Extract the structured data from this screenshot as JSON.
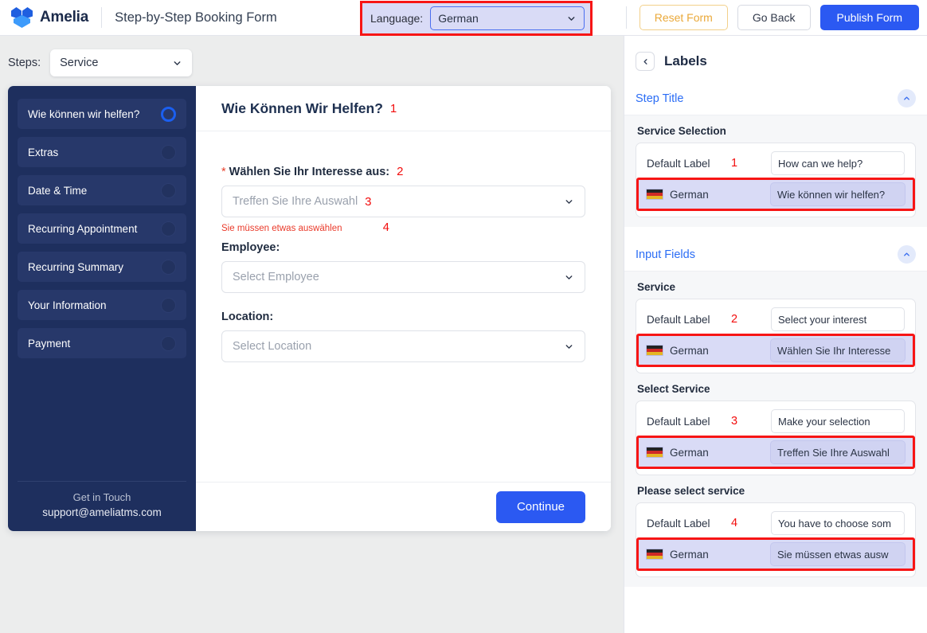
{
  "topbar": {
    "brand": "Amelia",
    "form_title": "Step-by-Step Booking Form",
    "language_label": "Language:",
    "language_value": "German",
    "reset_label": "Reset Form",
    "goback_label": "Go Back",
    "publish_label": "Publish Form",
    "accent_blue": "#2b59f2",
    "highlight_red": "#f71515",
    "lang_bg": "#d9dbf6"
  },
  "steps_bar": {
    "label": "Steps:",
    "value": "Service"
  },
  "booking": {
    "sidebar_steps": [
      {
        "label": "Wie können wir helfen?",
        "active": true
      },
      {
        "label": "Extras",
        "active": false
      },
      {
        "label": "Date & Time",
        "active": false
      },
      {
        "label": "Recurring Appointment",
        "active": false
      },
      {
        "label": "Recurring Summary",
        "active": false
      },
      {
        "label": "Your Information",
        "active": false
      },
      {
        "label": "Payment",
        "active": false
      }
    ],
    "get_in_touch": "Get in Touch",
    "support_email": "support@ameliatms.com",
    "step_title": "Wie Können Wir Helfen?",
    "step_title_marker": "1",
    "interest_label": "Wählen Sie Ihr Interesse aus:",
    "interest_required_mark": "*",
    "interest_marker": "2",
    "interest_placeholder": "Treffen Sie Ihre Auswahl",
    "interest_placeholder_marker": "3",
    "interest_error": "Sie müssen etwas auswählen",
    "interest_error_marker": "4",
    "employee_label": "Employee:",
    "employee_placeholder": "Select Employee",
    "location_label": "Location:",
    "location_placeholder": "Select Location",
    "continue_label": "Continue"
  },
  "right_panel": {
    "title": "Labels",
    "sections": [
      {
        "title": "Step Title",
        "collapsed": false
      },
      {
        "title": "Input Fields",
        "collapsed": false
      }
    ],
    "groups": [
      {
        "section": "Step Title",
        "group_title": "Service Selection",
        "default_row_label": "Default Label",
        "marker": "1",
        "default_value": "How can we help?",
        "lang_name": "German",
        "lang_value": "Wie können wir helfen?"
      },
      {
        "section": "Input Fields",
        "group_title": "Service",
        "default_row_label": "Default Label",
        "marker": "2",
        "default_value": "Select your interest",
        "lang_name": "German",
        "lang_value": "Wählen Sie Ihr Interesse"
      },
      {
        "section": "Input Fields",
        "group_title": "Select Service",
        "default_row_label": "Default Label",
        "marker": "3",
        "default_value": "Make your selection",
        "lang_name": "German",
        "lang_value": "Treffen Sie Ihre Auswahl"
      },
      {
        "section": "Input Fields",
        "group_title": "Please select service",
        "default_row_label": "Default Label",
        "marker": "4",
        "default_value": "You have to choose som",
        "lang_name": "German",
        "lang_value": "Sie müssen etwas ausw"
      }
    ]
  }
}
